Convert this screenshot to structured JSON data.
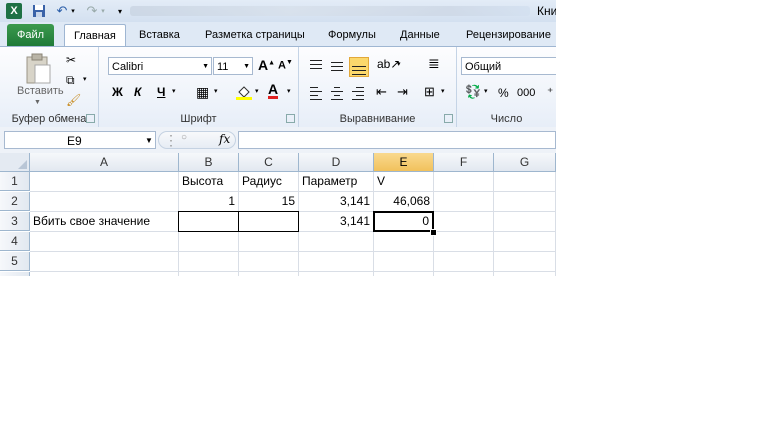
{
  "title_bar": {
    "title_fragment": "Кни"
  },
  "quick_access": {
    "undo_dd": "▾",
    "redo_dd": "▾",
    "customize": "▾"
  },
  "tabs": [
    {
      "label": "Файл"
    },
    {
      "label": "Главная"
    },
    {
      "label": "Вставка"
    },
    {
      "label": "Разметка страницы"
    },
    {
      "label": "Формулы"
    },
    {
      "label": "Данные"
    },
    {
      "label": "Рецензирование"
    }
  ],
  "ribbon": {
    "clipboard": {
      "paste_label": "Вставить",
      "group_label": "Буфер обмена"
    },
    "font": {
      "font_name": "Calibri",
      "font_size": "11",
      "bold": "Ж",
      "italic": "К",
      "underline": "Ч",
      "group_label": "Шрифт"
    },
    "alignment": {
      "group_label": "Выравнивание"
    },
    "number": {
      "format": "Общий",
      "percent": "%",
      "thousands": "000",
      "group_label": "Число"
    }
  },
  "formula_bar": {
    "name_box": "E9",
    "fx": "fx",
    "formula": ""
  },
  "grid": {
    "columns": [
      "A",
      "B",
      "C",
      "D",
      "E",
      "F",
      "G"
    ],
    "rows": [
      "1",
      "2",
      "3",
      "4",
      "5",
      "6"
    ],
    "cells": {
      "B1": "Высота",
      "C1": "Радиус",
      "D1": "Параметр",
      "E1": "V",
      "B2": "1",
      "C2": "15",
      "D2": "3,141",
      "E2": "46,068",
      "A3": "Вбить свое значение",
      "D3": "3,141",
      "E3": "0"
    }
  },
  "colors": {
    "selected_header": "#f1c15c",
    "file_tab": "#2a8a42",
    "highlight_button": "#fbd86c"
  }
}
